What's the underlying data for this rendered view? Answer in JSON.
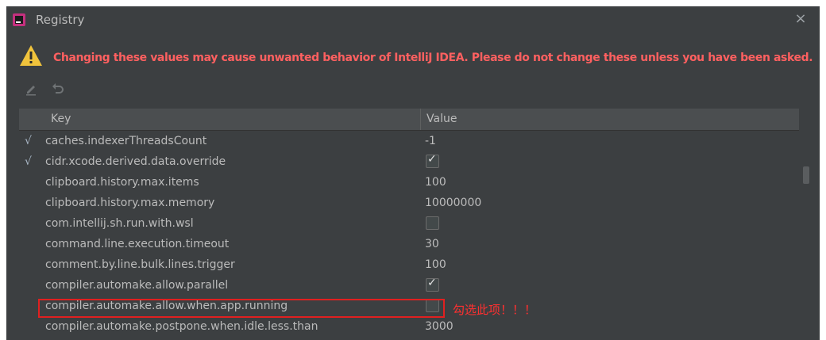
{
  "window": {
    "title": "Registry",
    "close_glyph": "×"
  },
  "warning": {
    "icon": "warning-triangle-icon",
    "text": "Changing these values may cause unwanted behavior of IntelliJ IDEA. Please do not change these unless you have been asked."
  },
  "toolbar": {
    "edit_icon": "edit-icon",
    "revert_icon": "revert-icon"
  },
  "table": {
    "columns": [
      "Key",
      "Value"
    ],
    "rows": [
      {
        "modified": true,
        "mark": "√",
        "key": "caches.indexerThreadsCount",
        "type": "text",
        "value": "-1"
      },
      {
        "modified": true,
        "mark": "√",
        "key": "cidr.xcode.derived.data.override",
        "type": "bool",
        "checked": true
      },
      {
        "modified": false,
        "mark": "",
        "key": "clipboard.history.max.items",
        "type": "text",
        "value": "100"
      },
      {
        "modified": false,
        "mark": "",
        "key": "clipboard.history.max.memory",
        "type": "text",
        "value": "10000000"
      },
      {
        "modified": false,
        "mark": "",
        "key": "com.intellij.sh.run.with.wsl",
        "type": "bool",
        "checked": false
      },
      {
        "modified": false,
        "mark": "",
        "key": "command.line.execution.timeout",
        "type": "text",
        "value": "30"
      },
      {
        "modified": false,
        "mark": "",
        "key": "comment.by.line.bulk.lines.trigger",
        "type": "text",
        "value": "100"
      },
      {
        "modified": false,
        "mark": "",
        "key": "compiler.automake.allow.parallel",
        "type": "bool",
        "checked": true
      },
      {
        "modified": false,
        "mark": "",
        "key": "compiler.automake.allow.when.app.running",
        "type": "bool",
        "checked": false
      },
      {
        "modified": false,
        "mark": "",
        "key": "compiler.automake.postpone.when.idle.less.than",
        "type": "text",
        "value": "3000"
      }
    ]
  },
  "annotation": {
    "text": "勾选此项！！！",
    "color": "#ff3030"
  },
  "colors": {
    "background": "#3c3f41",
    "warning": "#ff6060",
    "text": "#bbbbbb"
  }
}
